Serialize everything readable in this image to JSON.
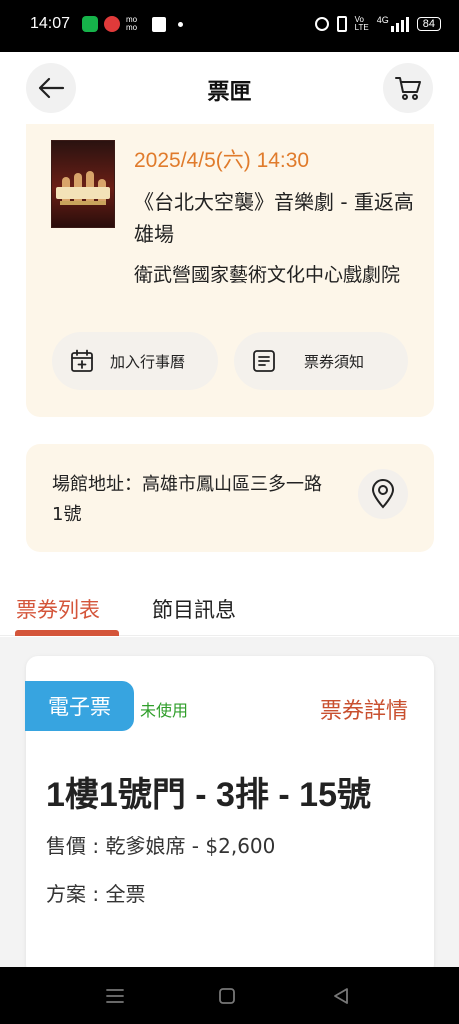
{
  "status_bar": {
    "time": "14:07",
    "momo_top": "mo",
    "momo_bottom": "mo",
    "lte_top": "Vo",
    "lte_bottom": "LTE",
    "network": "4G",
    "battery": "84"
  },
  "header": {
    "title": "票匣"
  },
  "event": {
    "datetime": "2025/4/5(六) 14:30",
    "name": "《台北大空襲》音樂劇 - 重返高雄場",
    "venue": "衛武營國家藝術文化中心戲劇院",
    "calendar_label": "加入行事曆",
    "notice_label": "票券須知"
  },
  "address": {
    "text": "場館地址：高雄市鳳山區三多一路1號"
  },
  "tabs": [
    {
      "label": "票券列表",
      "active": true
    },
    {
      "label": "節目訊息",
      "active": false
    }
  ],
  "ticket": {
    "type_tag": "電子票",
    "status": "未使用",
    "detail_link": "票券詳情",
    "seat": "1樓1號門 - 3排 - 15號",
    "price": "售價 : 乾爹娘席 - $2,600",
    "plan": "方案 : 全票"
  },
  "colors": {
    "accent": "#d4553a",
    "date": "#e07b2c",
    "card_bg": "#fdf6e9",
    "etag": "#37a4e0",
    "status_green": "#2f9e2a"
  },
  "icons": {
    "back": "arrow-left-icon",
    "cart": "cart-icon",
    "calendar": "calendar-plus-icon",
    "notice": "document-list-icon",
    "location": "map-pin-icon"
  }
}
